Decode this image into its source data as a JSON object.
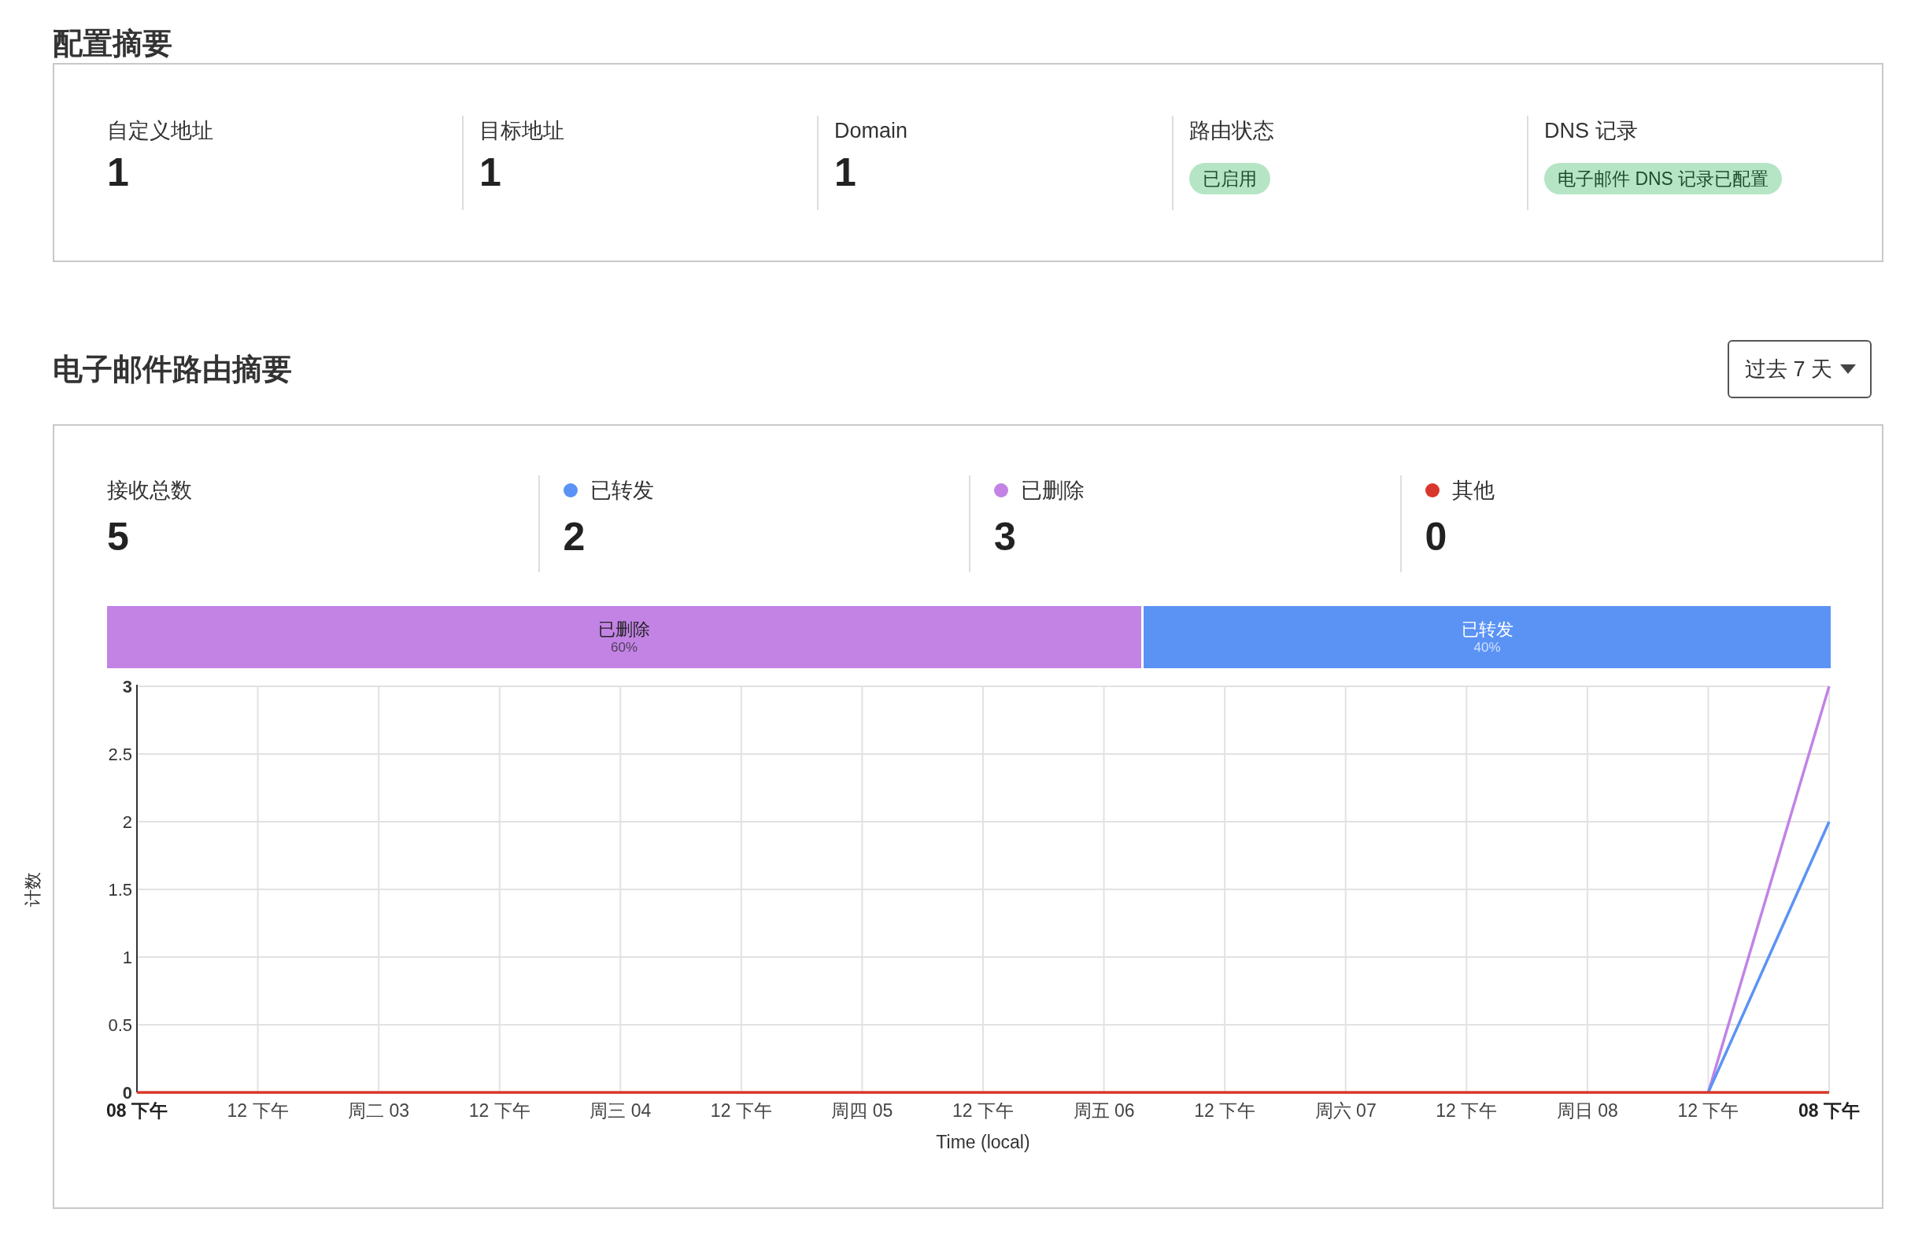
{
  "config_summary": {
    "title": "配置摘要",
    "items": [
      {
        "label": "自定义地址",
        "kind": "number",
        "value": "1"
      },
      {
        "label": "目标地址",
        "kind": "number",
        "value": "1"
      },
      {
        "label": "Domain",
        "kind": "number",
        "value": "1"
      },
      {
        "label": "路由状态",
        "kind": "badge",
        "value": "已启用"
      },
      {
        "label": "DNS 记录",
        "kind": "badge",
        "value": "电子邮件 DNS 记录已配置"
      }
    ]
  },
  "routing_summary": {
    "title": "电子邮件路由摘要",
    "range_dropdown": "过去 7 天",
    "stats": [
      {
        "label": "接收总数",
        "value": "5"
      },
      {
        "label": "已转发",
        "value": "2",
        "color": "#5b93f5"
      },
      {
        "label": "已删除",
        "value": "3",
        "color": "#c283e5"
      },
      {
        "label": "其他",
        "value": "0",
        "color": "#d9372b"
      }
    ],
    "distribution": [
      {
        "label": "已删除",
        "percent": "60%",
        "level": 0.6,
        "color": "#c283e5"
      },
      {
        "label": "已转发",
        "percent": "40%",
        "color": "#5b93f5"
      }
    ],
    "chart_data": {
      "type": "line",
      "xlabel": "Time (local)",
      "ylabel": "计数",
      "categories": [
        "08 下午",
        "12 下午",
        "周二 03",
        "12 下午",
        "周三 04",
        "12 下午",
        "周四 05",
        "12 下午",
        "周五 06",
        "12 下午",
        "周六 07",
        "12 下午",
        "周日 08",
        "12 下午",
        "08 下午"
      ],
      "series": [
        {
          "color": "#c283e5",
          "values": [
            null,
            null,
            null,
            null,
            null,
            null,
            null,
            null,
            null,
            null,
            null,
            null,
            null,
            0,
            3
          ]
        },
        {
          "color": "#5b93f5",
          "values": [
            null,
            null,
            null,
            null,
            null,
            null,
            null,
            null,
            null,
            null,
            null,
            null,
            null,
            0,
            2
          ]
        },
        {
          "color": "#d9372b",
          "values": [
            0,
            0,
            0,
            0,
            0,
            0,
            0,
            0,
            0,
            0,
            0,
            0,
            0,
            0,
            0
          ]
        }
      ],
      "grid": true,
      "ylim": [
        0,
        3
      ],
      "yticks": [
        0,
        0.5,
        1,
        1.5,
        2,
        2.5,
        3
      ]
    }
  }
}
